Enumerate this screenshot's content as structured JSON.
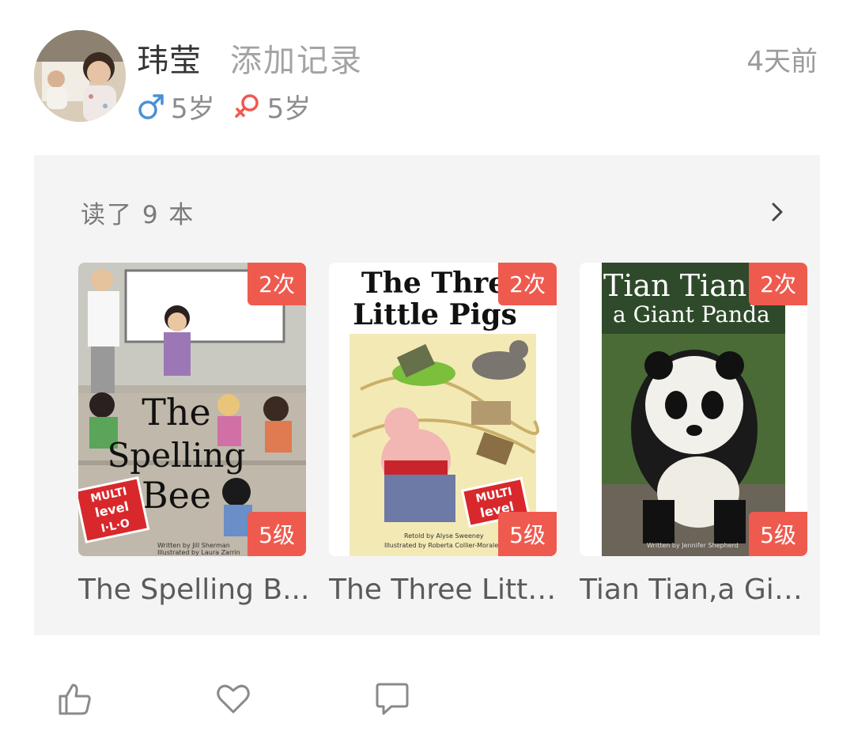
{
  "post": {
    "user_name": "玮莹",
    "action": "添加记录",
    "time": "4天前",
    "children": [
      {
        "gender": "male",
        "icon": "male-symbol-icon",
        "age": "5岁",
        "color": "#4a8fd6"
      },
      {
        "gender": "female",
        "icon": "female-symbol-icon",
        "age": "5岁",
        "color": "#ef5a4f"
      }
    ]
  },
  "reading": {
    "summary": "读了 9 本",
    "books": [
      {
        "title": "The Spelling B...",
        "count": "2次",
        "level": "5级",
        "cover_text": [
          "The",
          "Spelling",
          "Bee"
        ],
        "cover_badge": [
          "MULTI",
          "level",
          "I·L·O"
        ],
        "cover_credits": [
          "Written by Jill Sherman",
          "Illustrated by Laura Zarrin"
        ]
      },
      {
        "title": "The Three Littl...",
        "count": "2次",
        "level": "5级",
        "cover_text": [
          "The Three",
          "Little Pigs"
        ],
        "cover_badge": [
          "MULTI",
          "level"
        ],
        "cover_credits": [
          "Retold by Alyse Sweeney",
          "Illustrated by Roberta Collier-Morales"
        ]
      },
      {
        "title": "Tian Tian,a Gia...",
        "count": "2次",
        "level": "5级",
        "cover_text": [
          "Tian Tian",
          "a Giant Panda"
        ],
        "cover_credits": [
          "Written by Jennifer Shepherd"
        ]
      }
    ]
  },
  "colors": {
    "badge": "#ef5a4f",
    "card_bg": "#f4f4f4"
  },
  "actions": [
    {
      "name": "like-icon"
    },
    {
      "name": "favorite-heart-icon"
    },
    {
      "name": "comment-icon"
    }
  ]
}
